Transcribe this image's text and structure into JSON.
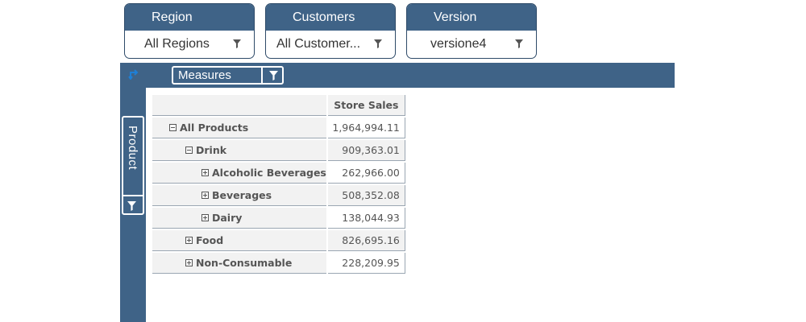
{
  "filters": [
    {
      "title": "Region",
      "value": "All Regions"
    },
    {
      "title": "Customers",
      "value": "All Customer..."
    },
    {
      "title": "Version",
      "value": "versione4"
    }
  ],
  "columns_area": {
    "label": "Measures"
  },
  "rows_area": {
    "label": "Product"
  },
  "table": {
    "measure_header": "Store Sales",
    "rows": [
      {
        "label": "All Products",
        "value": "1,964,994.11",
        "toggle": "minus",
        "level": 0
      },
      {
        "label": "Drink",
        "value": "909,363.01",
        "toggle": "minus",
        "level": 1
      },
      {
        "label": "Alcoholic Beverages",
        "value": "262,966.00",
        "toggle": "plus",
        "level": 2
      },
      {
        "label": "Beverages",
        "value": "508,352.08",
        "toggle": "plus",
        "level": 2
      },
      {
        "label": "Dairy",
        "value": "138,044.93",
        "toggle": "plus",
        "level": 2
      },
      {
        "label": "Food",
        "value": "826,695.16",
        "toggle": "plus",
        "level": 1
      },
      {
        "label": "Non-Consumable",
        "value": "228,209.95",
        "toggle": "plus",
        "level": 1
      }
    ]
  },
  "icons": {
    "filter": "funnel-icon",
    "swap": "swap-axes-icon",
    "expand": "plus-box-icon",
    "collapse": "minus-box-icon"
  },
  "colors": {
    "header_bg": "#3f6387",
    "accent": "#1e7fd6",
    "cell_bg": "#f2f2f2"
  }
}
